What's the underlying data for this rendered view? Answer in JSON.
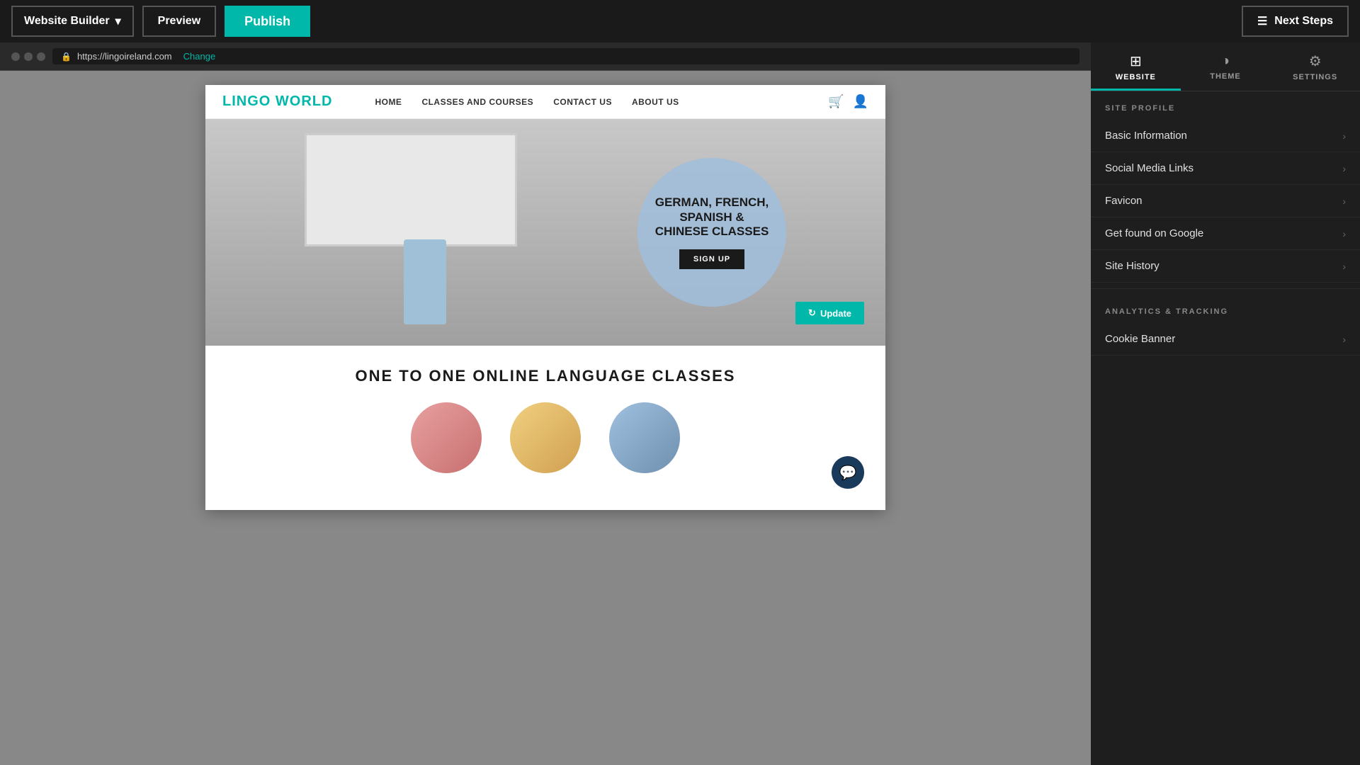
{
  "topbar": {
    "website_builder_label": "Website Builder",
    "preview_label": "Preview",
    "publish_label": "Publish",
    "next_steps_label": "Next Steps"
  },
  "browser": {
    "url": "https://lingoireland.com",
    "change_label": "Change"
  },
  "site": {
    "logo": "LINGO WORLD",
    "nav": {
      "links": [
        {
          "label": "HOME"
        },
        {
          "label": "CLASSES AND COURSES"
        },
        {
          "label": "CONTACT US"
        },
        {
          "label": "ABOUT US"
        }
      ]
    },
    "hero": {
      "circle_text": "GERMAN, FRENCH, SPANISH & CHINESE CLASSES",
      "signup_label": "SIGN UP",
      "update_label": "Update"
    },
    "content": {
      "title": "ONE TO ONE ONLINE LANGUAGE CLASSES"
    }
  },
  "right_panel": {
    "tabs": [
      {
        "label": "WEBSITE",
        "icon": "⊞",
        "active": true
      },
      {
        "label": "THEME",
        "icon": "◑"
      },
      {
        "label": "SETTINGS",
        "icon": "⚙"
      }
    ],
    "site_profile_header": "SITE PROFILE",
    "site_profile_items": [
      {
        "label": "Basic Information"
      },
      {
        "label": "Social Media Links"
      },
      {
        "label": "Favicon"
      },
      {
        "label": "Get found on Google"
      },
      {
        "label": "Site History"
      }
    ],
    "analytics_header": "ANALYTICS & TRACKING",
    "analytics_items": [
      {
        "label": "Cookie Banner"
      }
    ]
  }
}
